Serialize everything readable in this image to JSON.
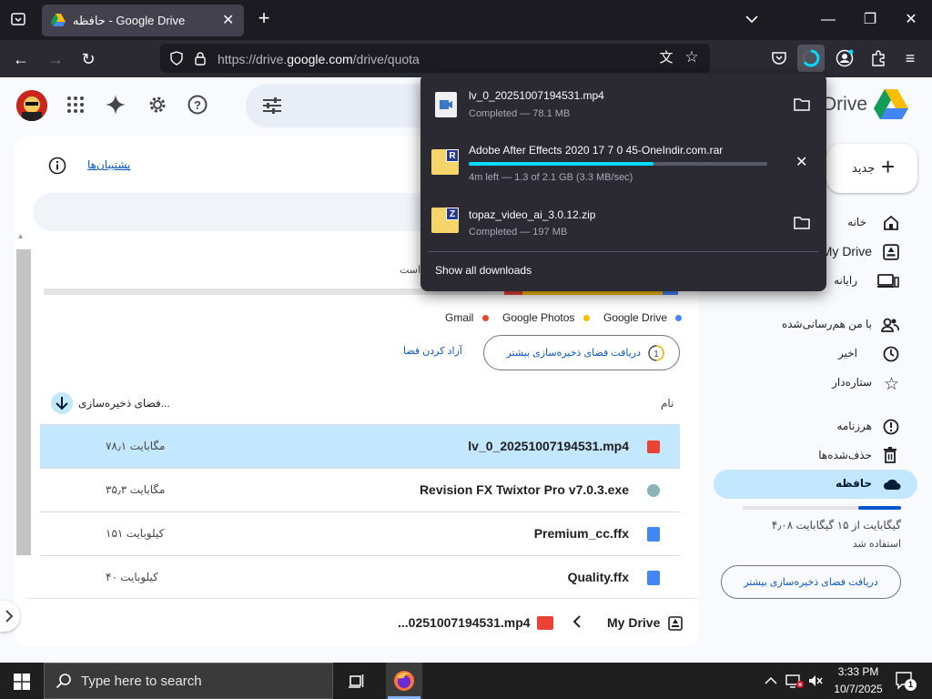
{
  "browser": {
    "tab_title": "حافظه - Google Drive",
    "new_tab": "+",
    "url_prefix": "https://drive.",
    "url_domain": "google.com",
    "url_path": "/drive/quota"
  },
  "drive": {
    "logo_text": "Drive",
    "new_button": "جدید",
    "support_link": "پشتیبان‌ها",
    "nav": [
      {
        "label": "خانه",
        "icon": "home-icon"
      },
      {
        "label": "My Drive",
        "icon": "my-drive-icon"
      },
      {
        "label": "رایانه",
        "icon": "computer-icon"
      },
      {
        "label": "با من هم‌رسانی‌شده",
        "icon": "shared-icon"
      },
      {
        "label": "اخیر",
        "icon": "clock-icon"
      },
      {
        "label": "ستاره‌دار",
        "icon": "star-icon"
      },
      {
        "label": "هرزنامه",
        "icon": "spam-icon"
      },
      {
        "label": "حذف‌شده‌ها",
        "icon": "trash-icon"
      },
      {
        "label": "حافظه",
        "icon": "cloud-icon"
      }
    ],
    "storage": {
      "usage_text": "۴٫۰۸ گیگابایت از ۱۵ گیگابایت",
      "usage_sub": "استفاده شد",
      "used_fraction": 0.27,
      "get_more": "دریافت فضای ذخیره‌سازی بیشتر"
    },
    "storage_line_partial": "است",
    "legend": [
      {
        "label": "Google Drive",
        "color": "#4285f4"
      },
      {
        "label": "Google Photos",
        "color": "#fbbc04"
      },
      {
        "label": "Gmail",
        "color": "#ea4335"
      }
    ],
    "buy_storage_button": "دریافت فضای ذخیره‌سازی بیشتر",
    "free_space_link": "آزاد کردن فضا",
    "table": {
      "col_name": "نام",
      "col_storage": "فضای ذخیره‌سازی...",
      "rows": [
        {
          "name": "lv_0_20251007194531.mp4",
          "size": "۷۸٫۱ مگابایت",
          "icon": "video-file-icon",
          "selected": true
        },
        {
          "name": "Revision FX Twixtor Pro v7.0.3.exe",
          "size": "۳۵٫۳ مگابایت",
          "icon": "exe-file-icon",
          "selected": false
        },
        {
          "name": "Premium_cc.ffx",
          "size": "۱۵۱ کیلوبایت",
          "icon": "doc-file-icon",
          "selected": false
        },
        {
          "name": "Quality.ffx",
          "size": "۴۰ کیلوبایت",
          "icon": "doc-file-icon",
          "selected": false
        }
      ]
    },
    "breadcrumb": {
      "root": "My Drive",
      "file": "...0251007194531.mp4"
    }
  },
  "downloads": {
    "items": [
      {
        "name": "lv_0_20251007194531.mp4",
        "status": "Completed — 78.1 MB"
      },
      {
        "name": "Adobe After Effects 2020 17 7 0 45-OneIndir.com.rar",
        "status": "4m left — 1.3 of 2.1 GB (3.3 MB/sec)",
        "progress": 0.62
      },
      {
        "name": "topaz_video_ai_3.0.12.zip",
        "status": "Completed — 197 MB"
      }
    ],
    "show_all": "Show all downloads"
  },
  "taskbar": {
    "search_placeholder": "Type here to search",
    "time": "3:33 PM",
    "date": "10/7/2025",
    "notification_count": "1"
  },
  "colors": {
    "accent": "#0b57d0",
    "selected_row": "#c2e7ff",
    "progress": "#00ddff"
  }
}
